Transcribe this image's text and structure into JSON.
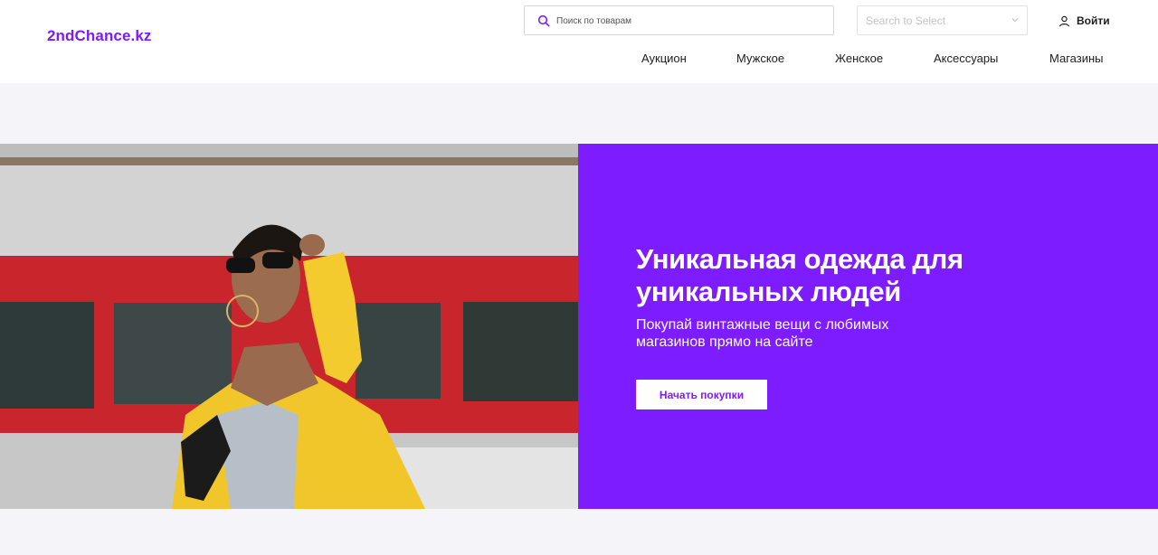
{
  "header": {
    "logo": "2ndChance.kz",
    "search": {
      "placeholder": "Поиск по товарам",
      "value": ""
    },
    "select": {
      "placeholder": "Search to Select"
    },
    "login_label": "Войти",
    "nav": [
      "Аукцион",
      "Мужское",
      "Женское",
      "Аксессуары",
      "Магазины"
    ]
  },
  "hero": {
    "title": "Уникальная одежда для уникальных людей",
    "subtitle": "Покупай винтажные вещи с любимых магазинов прямо на сайте",
    "cta": "Начать покупки",
    "image_alt": "woman in yellow jacket and sunglasses"
  },
  "colors": {
    "accent": "#7d1cff",
    "logo": "#7a1cff",
    "background": "#f5f4f8"
  },
  "icons": {
    "search": "search-icon",
    "select": "chevron-down-icon",
    "login": "user-icon"
  }
}
